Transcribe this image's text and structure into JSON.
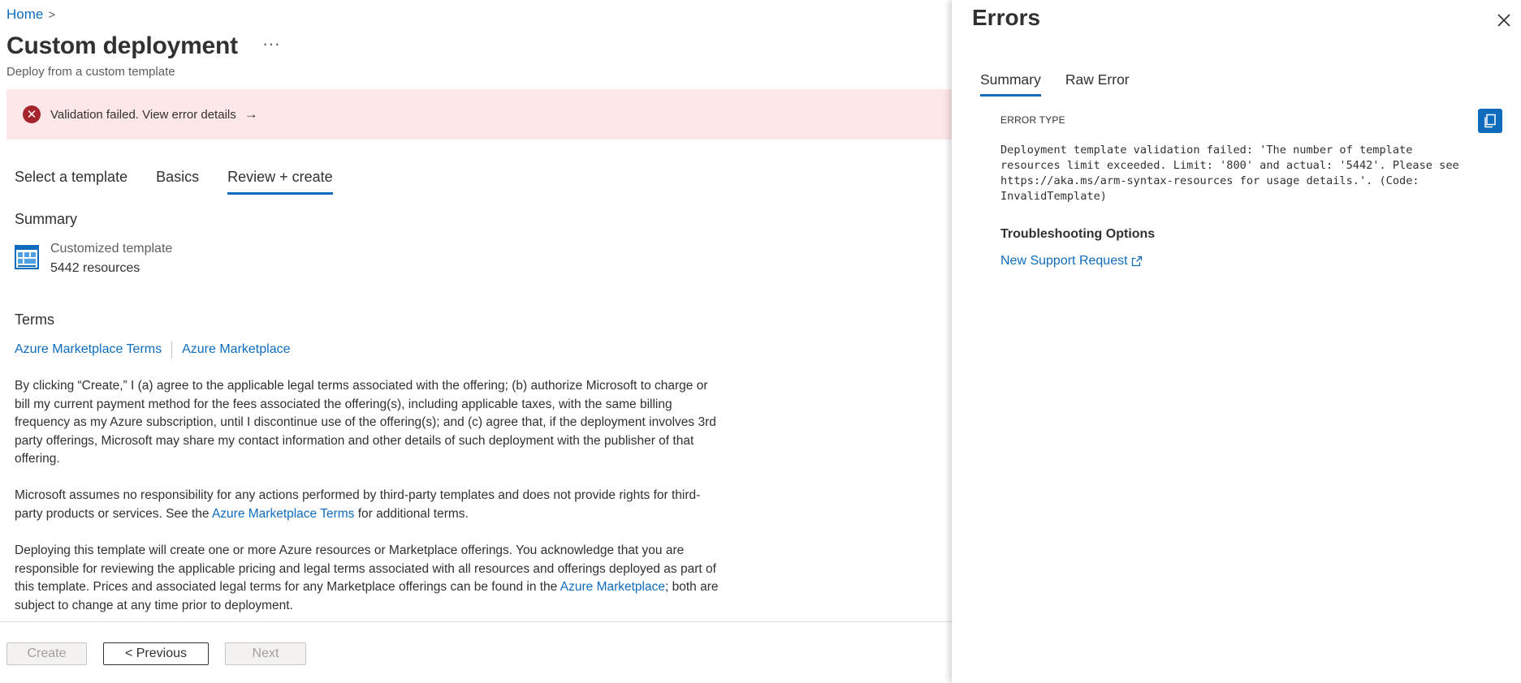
{
  "breadcrumb": {
    "home": "Home",
    "separator": ">"
  },
  "header": {
    "title": "Custom deployment",
    "more": "···",
    "subtitle": "Deploy from a custom template"
  },
  "banner": {
    "message": "Validation failed. View error details",
    "arrow": "→"
  },
  "tabs": [
    {
      "label": "Select a template",
      "active": false
    },
    {
      "label": "Basics",
      "active": false
    },
    {
      "label": "Review + create",
      "active": true
    }
  ],
  "summary": {
    "heading": "Summary",
    "template_name": "Customized template",
    "resource_count": "5442 resources"
  },
  "terms": {
    "heading": "Terms",
    "link1": "Azure Marketplace Terms",
    "link2": "Azure Marketplace",
    "para1": "By clicking “Create,” I (a) agree to the applicable legal terms associated with the offering; (b) authorize Microsoft to charge or bill my current payment method for the fees associated the offering(s), including applicable taxes, with the same billing frequency as my Azure subscription, until I discontinue use of the offering(s); and (c) agree that, if the deployment involves 3rd party offerings, Microsoft may share my contact information and other details of such deployment with the publisher of that offering.",
    "para2_before": "Microsoft assumes no responsibility for any actions performed by third-party templates and does not provide rights for third-party products or services. See the ",
    "para2_link": "Azure Marketplace Terms",
    "para2_after": " for additional terms.",
    "para3_before": "Deploying this template will create one or more Azure resources or Marketplace offerings.  You acknowledge that you are responsible for reviewing the applicable pricing and legal terms associated with all resources and offerings deployed as part of this template.  Prices and associated legal terms for any Marketplace offerings can be found in the ",
    "para3_link": "Azure Marketplace",
    "para3_after": "; both are subject to change at any time prior to deployment."
  },
  "footer": {
    "create": "Create",
    "previous": "< Previous",
    "next": "Next"
  },
  "errors_panel": {
    "title": "Errors",
    "tabs": [
      {
        "label": "Summary",
        "active": true
      },
      {
        "label": "Raw Error",
        "active": false
      }
    ],
    "error_type_label": "ERROR TYPE",
    "error_message": "Deployment template validation failed: 'The number of template\nresources limit exceeded. Limit: '800' and actual: '5442'. Please see\nhttps://aka.ms/arm-syntax-resources for usage details.'. (Code:\nInvalidTemplate)",
    "troubleshooting_heading": "Troubleshooting Options",
    "support_link": "New Support Request"
  },
  "colors": {
    "accent": "#0f6cbd",
    "error": "#a4262c",
    "error_bg": "#fde7e9"
  },
  "icons": [
    "chevron-right-icon",
    "ellipsis-icon",
    "error-circle-icon",
    "arrow-right-icon",
    "template-grid-icon",
    "close-icon",
    "copy-icon",
    "external-link-icon"
  ]
}
